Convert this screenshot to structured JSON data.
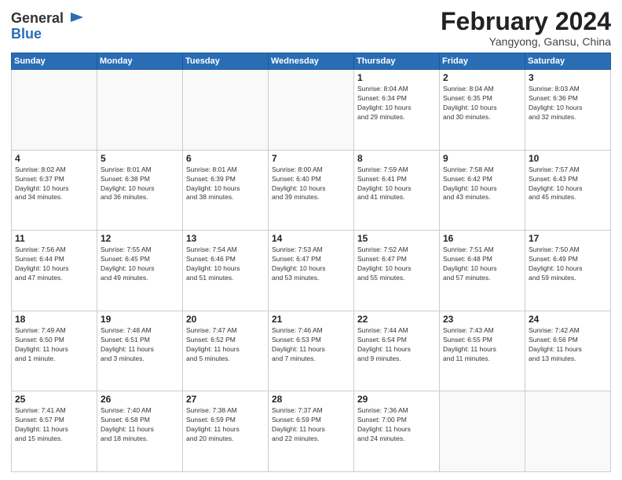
{
  "header": {
    "logo_line1": "General",
    "logo_line2": "Blue",
    "month": "February 2024",
    "location": "Yangyong, Gansu, China"
  },
  "weekdays": [
    "Sunday",
    "Monday",
    "Tuesday",
    "Wednesday",
    "Thursday",
    "Friday",
    "Saturday"
  ],
  "weeks": [
    [
      {
        "day": "",
        "info": ""
      },
      {
        "day": "",
        "info": ""
      },
      {
        "day": "",
        "info": ""
      },
      {
        "day": "",
        "info": ""
      },
      {
        "day": "1",
        "info": "Sunrise: 8:04 AM\nSunset: 6:34 PM\nDaylight: 10 hours\nand 29 minutes."
      },
      {
        "day": "2",
        "info": "Sunrise: 8:04 AM\nSunset: 6:35 PM\nDaylight: 10 hours\nand 30 minutes."
      },
      {
        "day": "3",
        "info": "Sunrise: 8:03 AM\nSunset: 6:36 PM\nDaylight: 10 hours\nand 32 minutes."
      }
    ],
    [
      {
        "day": "4",
        "info": "Sunrise: 8:02 AM\nSunset: 6:37 PM\nDaylight: 10 hours\nand 34 minutes."
      },
      {
        "day": "5",
        "info": "Sunrise: 8:01 AM\nSunset: 6:38 PM\nDaylight: 10 hours\nand 36 minutes."
      },
      {
        "day": "6",
        "info": "Sunrise: 8:01 AM\nSunset: 6:39 PM\nDaylight: 10 hours\nand 38 minutes."
      },
      {
        "day": "7",
        "info": "Sunrise: 8:00 AM\nSunset: 6:40 PM\nDaylight: 10 hours\nand 39 minutes."
      },
      {
        "day": "8",
        "info": "Sunrise: 7:59 AM\nSunset: 6:41 PM\nDaylight: 10 hours\nand 41 minutes."
      },
      {
        "day": "9",
        "info": "Sunrise: 7:58 AM\nSunset: 6:42 PM\nDaylight: 10 hours\nand 43 minutes."
      },
      {
        "day": "10",
        "info": "Sunrise: 7:57 AM\nSunset: 6:43 PM\nDaylight: 10 hours\nand 45 minutes."
      }
    ],
    [
      {
        "day": "11",
        "info": "Sunrise: 7:56 AM\nSunset: 6:44 PM\nDaylight: 10 hours\nand 47 minutes."
      },
      {
        "day": "12",
        "info": "Sunrise: 7:55 AM\nSunset: 6:45 PM\nDaylight: 10 hours\nand 49 minutes."
      },
      {
        "day": "13",
        "info": "Sunrise: 7:54 AM\nSunset: 6:46 PM\nDaylight: 10 hours\nand 51 minutes."
      },
      {
        "day": "14",
        "info": "Sunrise: 7:53 AM\nSunset: 6:47 PM\nDaylight: 10 hours\nand 53 minutes."
      },
      {
        "day": "15",
        "info": "Sunrise: 7:52 AM\nSunset: 6:47 PM\nDaylight: 10 hours\nand 55 minutes."
      },
      {
        "day": "16",
        "info": "Sunrise: 7:51 AM\nSunset: 6:48 PM\nDaylight: 10 hours\nand 57 minutes."
      },
      {
        "day": "17",
        "info": "Sunrise: 7:50 AM\nSunset: 6:49 PM\nDaylight: 10 hours\nand 59 minutes."
      }
    ],
    [
      {
        "day": "18",
        "info": "Sunrise: 7:49 AM\nSunset: 6:50 PM\nDaylight: 11 hours\nand 1 minute."
      },
      {
        "day": "19",
        "info": "Sunrise: 7:48 AM\nSunset: 6:51 PM\nDaylight: 11 hours\nand 3 minutes."
      },
      {
        "day": "20",
        "info": "Sunrise: 7:47 AM\nSunset: 6:52 PM\nDaylight: 11 hours\nand 5 minutes."
      },
      {
        "day": "21",
        "info": "Sunrise: 7:46 AM\nSunset: 6:53 PM\nDaylight: 11 hours\nand 7 minutes."
      },
      {
        "day": "22",
        "info": "Sunrise: 7:44 AM\nSunset: 6:54 PM\nDaylight: 11 hours\nand 9 minutes."
      },
      {
        "day": "23",
        "info": "Sunrise: 7:43 AM\nSunset: 6:55 PM\nDaylight: 11 hours\nand 11 minutes."
      },
      {
        "day": "24",
        "info": "Sunrise: 7:42 AM\nSunset: 6:56 PM\nDaylight: 11 hours\nand 13 minutes."
      }
    ],
    [
      {
        "day": "25",
        "info": "Sunrise: 7:41 AM\nSunset: 6:57 PM\nDaylight: 11 hours\nand 15 minutes."
      },
      {
        "day": "26",
        "info": "Sunrise: 7:40 AM\nSunset: 6:58 PM\nDaylight: 11 hours\nand 18 minutes."
      },
      {
        "day": "27",
        "info": "Sunrise: 7:38 AM\nSunset: 6:59 PM\nDaylight: 11 hours\nand 20 minutes."
      },
      {
        "day": "28",
        "info": "Sunrise: 7:37 AM\nSunset: 6:59 PM\nDaylight: 11 hours\nand 22 minutes."
      },
      {
        "day": "29",
        "info": "Sunrise: 7:36 AM\nSunset: 7:00 PM\nDaylight: 11 hours\nand 24 minutes."
      },
      {
        "day": "",
        "info": ""
      },
      {
        "day": "",
        "info": ""
      }
    ]
  ]
}
